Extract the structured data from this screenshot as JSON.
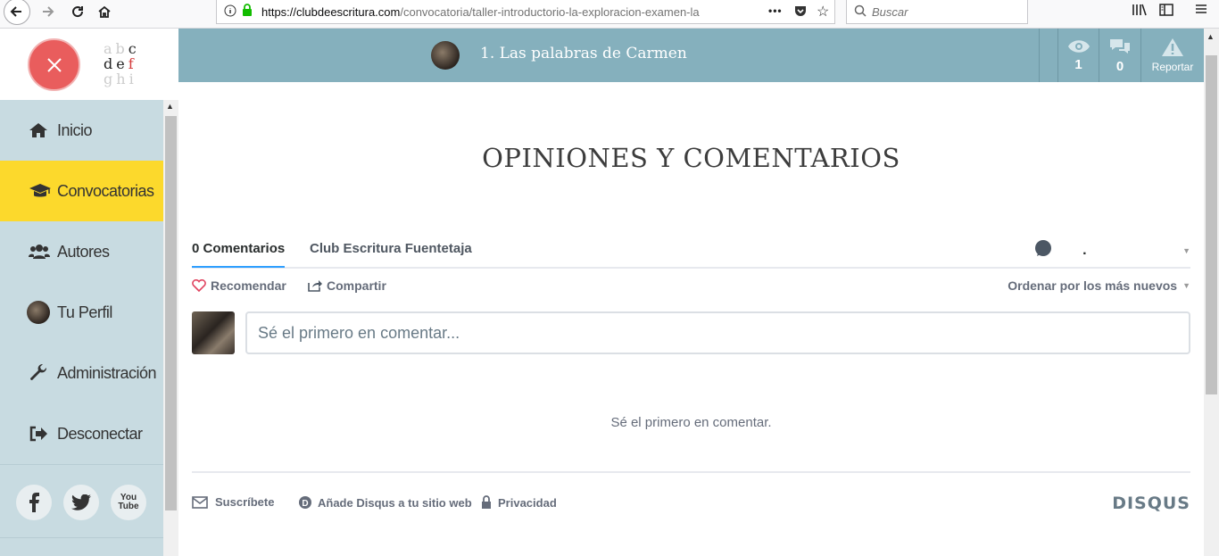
{
  "browser": {
    "url_domain": "https://clubdeescritura.com",
    "url_path": "/convocatoria/taller-introductorio-la-exploracion-examen-la",
    "search_placeholder": "Buscar",
    "url_more": "•••"
  },
  "logo": {
    "row1": [
      "a",
      "b",
      "c"
    ],
    "row2": [
      "d",
      "e",
      "f"
    ],
    "row3": [
      "g",
      "h",
      "i"
    ]
  },
  "sidebar": {
    "items": [
      {
        "label": "Inicio",
        "icon": "home-icon"
      },
      {
        "label": "Convocatorias",
        "icon": "graduation-cap-icon",
        "active": true
      },
      {
        "label": "Autores",
        "icon": "users-icon"
      },
      {
        "label": "Tu Perfil",
        "icon": "avatar"
      },
      {
        "label": "Administración",
        "icon": "wrench-icon"
      },
      {
        "label": "Desconectar",
        "icon": "sign-out-icon"
      }
    ],
    "social": [
      "facebook",
      "twitter",
      "youtube"
    ],
    "youtube_label": "You Tube"
  },
  "topbar": {
    "title": "1. Las palabras de Carmen",
    "views": "1",
    "comments": "0",
    "report_label": "Reportar"
  },
  "main": {
    "heading": "OPINIONES Y COMENTARIOS"
  },
  "disqus": {
    "tab_comments": "0 Comentarios",
    "tab_community": "Club Escritura Fuentetaja",
    "user_name": ".",
    "recommend": "Recomendar",
    "share": "Compartir",
    "sort": "Ordenar por los más nuevos",
    "placeholder": "Sé el primero en comentar...",
    "empty_message": "Sé el primero en comentar.",
    "subscribe": "Suscríbete",
    "add_disqus": "Añade Disqus a tu sitio web",
    "privacy": "Privacidad",
    "brand": "DISQUS"
  },
  "colors": {
    "topbar": "#85b0bd",
    "sidebar": "#c8dbe1",
    "active": "#fcd92c",
    "close": "#e95d5d"
  }
}
